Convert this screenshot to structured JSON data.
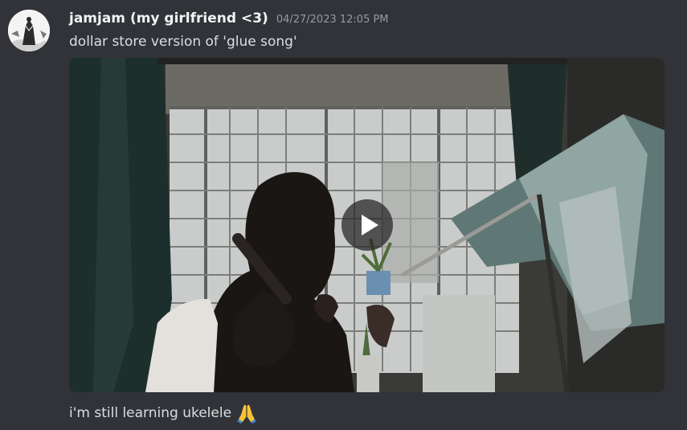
{
  "message": {
    "author": "jamjam (my girlfriend <3)",
    "timestamp": "04/27/2023 12:05 PM",
    "text_top": "dollar store version of 'glue song'",
    "text_bottom": "i'm still learning ukelele",
    "emoji": "folded-hands"
  },
  "attachment": {
    "type": "video",
    "play_icon": "play-icon"
  },
  "colors": {
    "background": "#313338",
    "username": "#f2f3f5",
    "timestamp": "#949ba4",
    "text": "#dbdee1"
  }
}
